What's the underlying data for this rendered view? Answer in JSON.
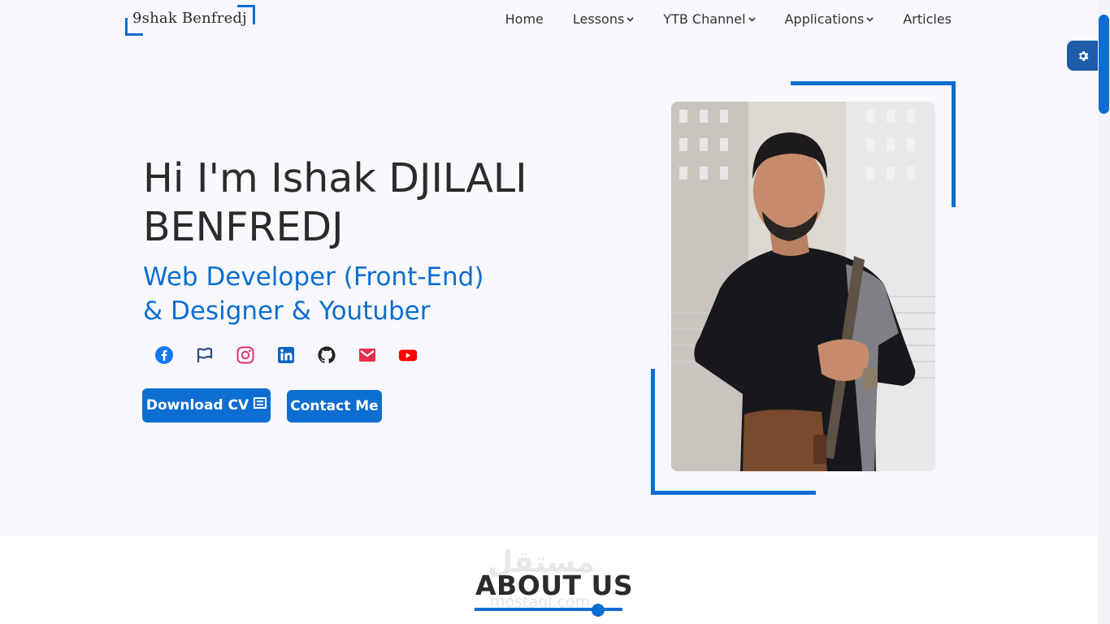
{
  "nav": {
    "logo_text": "9shak Benfredj",
    "items": [
      {
        "label": "Home",
        "has_dropdown": false
      },
      {
        "label": "Lessons",
        "has_dropdown": true
      },
      {
        "label": "YTB Channel",
        "has_dropdown": true
      },
      {
        "label": "Applications",
        "has_dropdown": true
      },
      {
        "label": "Articles",
        "has_dropdown": false
      }
    ]
  },
  "hero": {
    "title": "Hi I'm Ishak DJILALI BENFREDJ",
    "subtitle_line1": "Web Developer (Front-End)",
    "subtitle_line2": "& Designer & Youtuber",
    "socials": [
      "facebook-icon",
      "flag-icon",
      "instagram-icon",
      "linkedin-icon",
      "github-icon",
      "gmail-icon",
      "youtube-icon"
    ],
    "download_cv_label": "Download CV",
    "contact_label": "Contact Me"
  },
  "about": {
    "title": "ABOUT US",
    "watermark": "مستقل",
    "watermark_sub": "mostaql.com"
  },
  "colors": {
    "accent": "#0d6ed1",
    "hero_bg": "#f8f8fd",
    "text": "#2b2b2b",
    "facebook": "#1877f2",
    "instagram": "#e1306c",
    "linkedin": "#0a66c2",
    "gmail": "#ea4335",
    "youtube": "#ff0000"
  }
}
